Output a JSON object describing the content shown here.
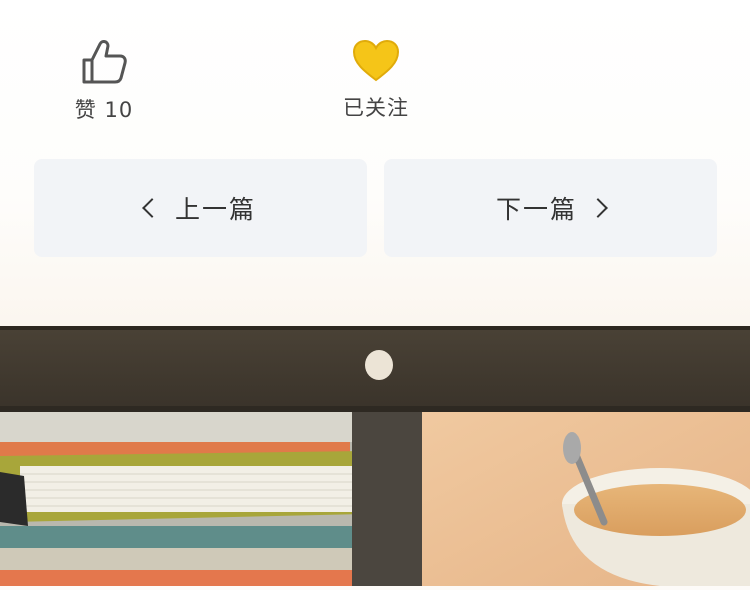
{
  "actions": {
    "like": {
      "icon": "thumbs-up-icon",
      "label": "赞 10"
    },
    "follow": {
      "icon": "heart-icon",
      "label": "已关注",
      "color": "#f5c518"
    }
  },
  "nav": {
    "prev_label": "上一篇",
    "next_label": "下一篇"
  },
  "colors": {
    "button_bg": "#f2f4f7",
    "text": "#333333",
    "heart": "#f5c518"
  }
}
